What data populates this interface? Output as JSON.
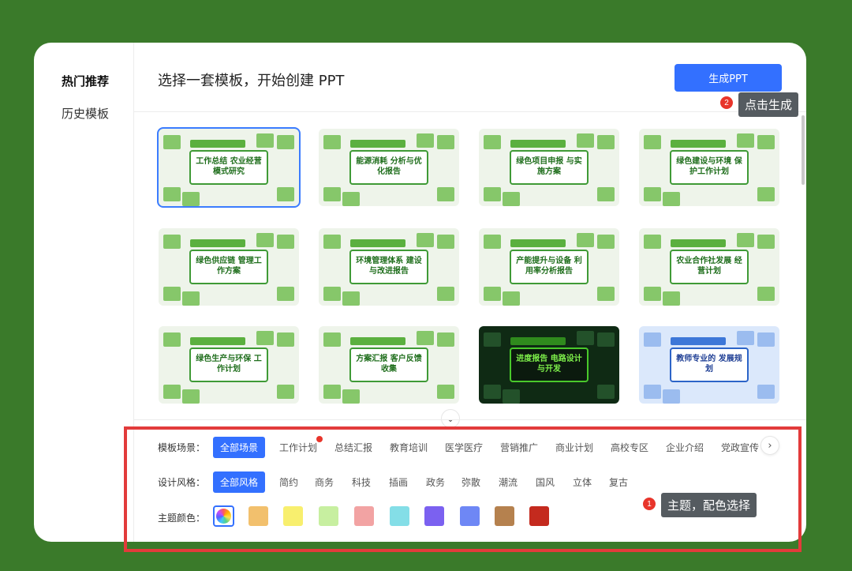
{
  "sidebar": {
    "items": [
      {
        "label": "热门推荐",
        "active": true
      },
      {
        "label": "历史模板",
        "active": false
      }
    ]
  },
  "header": {
    "title": "选择一套模板，开始创建 PPT",
    "generate_label": "生成PPT"
  },
  "templates": [
    {
      "title": "工作总结 农业经营模式研究",
      "selected": true,
      "theme": "green"
    },
    {
      "title": "能源消耗 分析与优化报告",
      "selected": false,
      "theme": "green"
    },
    {
      "title": "绿色项目申报 与实施方案",
      "selected": false,
      "theme": "green"
    },
    {
      "title": "绿色建设与环境 保护工作计划",
      "selected": false,
      "theme": "green"
    },
    {
      "title": "绿色供应链 管理工作方案",
      "selected": false,
      "theme": "green"
    },
    {
      "title": "环境管理体系 建设与改进报告",
      "selected": false,
      "theme": "green"
    },
    {
      "title": "产能提升与设备 利用率分析报告",
      "selected": false,
      "theme": "green"
    },
    {
      "title": "农业合作社发展 经营计划",
      "selected": false,
      "theme": "green"
    },
    {
      "title": "绿色生产与环保 工作计划",
      "selected": false,
      "theme": "green"
    },
    {
      "title": "方案汇报 客户反馈收集",
      "selected": false,
      "theme": "green"
    },
    {
      "title": "进度报告 电路设计与开发",
      "selected": false,
      "theme": "dark"
    },
    {
      "title": "教师专业的 发展规划",
      "selected": false,
      "theme": "blue"
    }
  ],
  "filters": {
    "scene": {
      "label": "模板场景：",
      "options": [
        "全部场景",
        "工作计划",
        "总结汇报",
        "教育培训",
        "医学医疗",
        "营销推广",
        "商业计划",
        "高校专区",
        "企业介绍",
        "党政宣传"
      ],
      "selected": "全部场景"
    },
    "style": {
      "label": "设计风格：",
      "options": [
        "全部风格",
        "简约",
        "商务",
        "科技",
        "插画",
        "政务",
        "弥散",
        "潮流",
        "国风",
        "立体",
        "复古"
      ],
      "selected": "全部风格"
    },
    "color": {
      "label": "主题颜色：",
      "swatches": [
        "multi",
        "#f2c06d",
        "#f8ef6e",
        "#c7efa0",
        "#f2a3a3",
        "#84dee7",
        "#7b61f0",
        "#6e87f5",
        "#b5814e",
        "#c42a1e"
      ],
      "selected": "multi"
    }
  },
  "annotations": {
    "step1_number": "1",
    "step1_text": "主题，配色选择",
    "step2_number": "2",
    "step2_text": "点击生成"
  },
  "colors": {
    "background": "#3a7a2a",
    "accent": "#3370ff",
    "highlight": "#e23b3b"
  }
}
